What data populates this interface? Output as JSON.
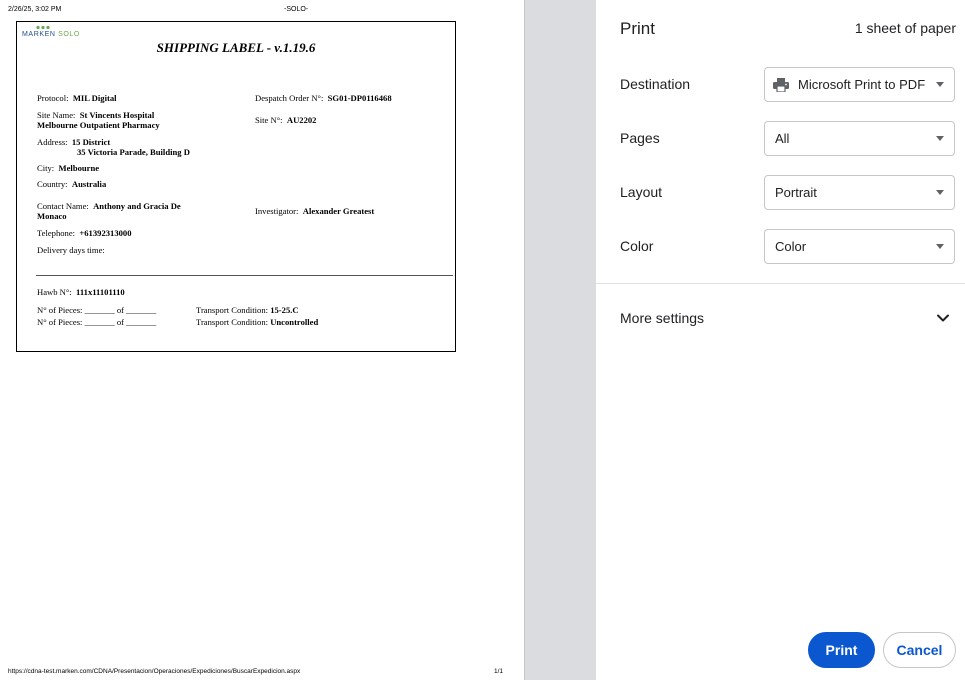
{
  "preview": {
    "header_date": "2/26/25, 3:02 PM",
    "header_title": "-SOLO-",
    "footer_url": "https://cdna-test.marken.com/CDNA/Presentacion/Operaciones/Expediciones/BuscarExpedicion.aspx",
    "footer_page": "1/1",
    "label": {
      "logo_brand": "MARKEN",
      "logo_sub": "SOLO",
      "title": "SHIPPING LABEL - v.1.19.6",
      "protocol_label": "Protocol:",
      "protocol_value": "MIL Digital",
      "despatch_label": "Despatch Order N°:",
      "despatch_value": "SG01-DP0116468",
      "site_name_label": "Site Name:",
      "site_name_line1": "St Vincents Hospital",
      "site_name_line2": "Melbourne Outpatient Pharmacy",
      "site_no_label": "Site N°:",
      "site_no_value": "AU2202",
      "address_label": "Address:",
      "address_line1": "15 District",
      "address_line2": "35 Victoria Parade, Building D",
      "city_label": "City:",
      "city_value": "Melbourne",
      "country_label": "Country:",
      "country_value": "Australia",
      "contact_label": "Contact Name:",
      "contact_line1": "Anthony and Gracia De",
      "contact_line2": "Monaco",
      "investigator_label": "Investigator:",
      "investigator_value": "Alexander Greatest",
      "telephone_label": "Telephone:",
      "telephone_value": "+61392313000",
      "delivery_label": "Delivery days time:",
      "hawb_label": "Hawb N°:",
      "hawb_value": "111x11101110",
      "pieces_row1": "N° of Pieces: _______ of _______",
      "pieces_row2": "N° of Pieces: _______ of _______",
      "transport_label": "Transport Condition:",
      "transport_value1": "15-25.C",
      "transport_value2": "Uncontrolled"
    }
  },
  "settings": {
    "title": "Print",
    "sheet_count": "1 sheet of paper",
    "destination_label": "Destination",
    "destination_value": "Microsoft Print to PDF",
    "pages_label": "Pages",
    "pages_value": "All",
    "layout_label": "Layout",
    "layout_value": "Portrait",
    "color_label": "Color",
    "color_value": "Color",
    "more_settings": "More settings",
    "print_button": "Print",
    "cancel_button": "Cancel"
  },
  "colors": {
    "accent": "#0b57d0",
    "gap_gray": "#dadce0",
    "logo_blue": "#1f4e8c",
    "logo_green": "#6aa84f"
  },
  "icons": {
    "destination": "printer-icon",
    "select_caret": "caret-down-icon",
    "more_settings": "chevron-down-icon"
  }
}
